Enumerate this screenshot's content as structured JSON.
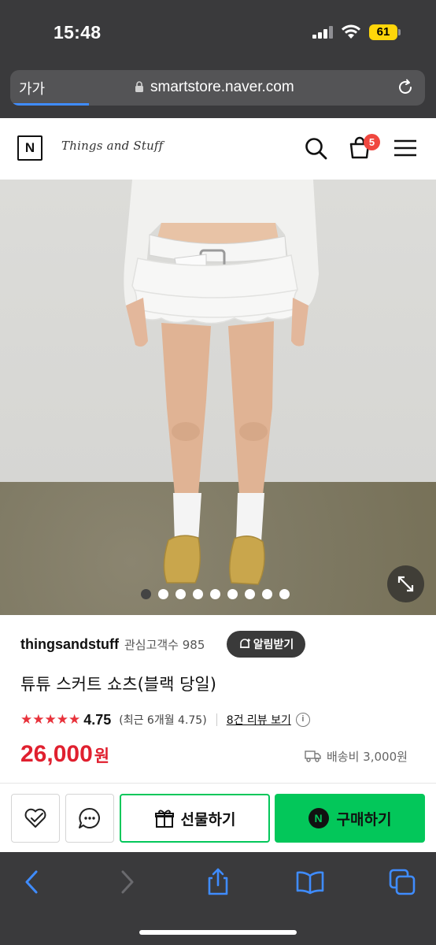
{
  "status_bar": {
    "time": "15:48",
    "battery": "61"
  },
  "browser": {
    "text_size_label": "가가",
    "url": "smartstore.naver.com",
    "load_progress": 0.19
  },
  "store": {
    "logo_letter": "N",
    "brand": "Things and Stuff",
    "cart_count": "5"
  },
  "gallery": {
    "image_count": 9,
    "active_index": 0
  },
  "product": {
    "seller": "thingsandstuff",
    "followers_label": "관심고객수 985",
    "alarm_label": "알림받기",
    "title": "튜튜 스커트 쇼츠(블랙 당일)",
    "stars": "★★★★★",
    "rating": "4.75",
    "recent_rating": "(최근 6개월 4.75)",
    "review_link": "8건 리뷰 보기",
    "info_icon": "i",
    "price": "26,000",
    "price_unit": "원",
    "shipping": "배송비 3,000원"
  },
  "actions": {
    "gift_label": "선물하기",
    "buy_label": "구매하기",
    "buy_logo": "N"
  },
  "colors": {
    "naver_green": "#03c75a",
    "price_red": "#e0202f",
    "star_red": "#e8323b",
    "badge_red": "#f0473f",
    "safari_chrome": "#3a3a3c",
    "link_blue": "#3f8cff"
  }
}
